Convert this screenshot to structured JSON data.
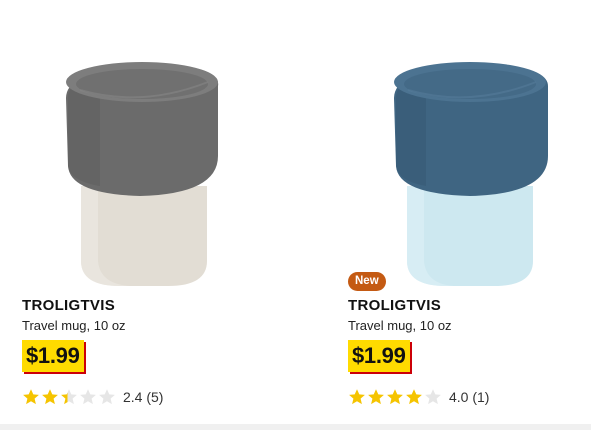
{
  "products": [
    {
      "badge": "",
      "name": "TROLIGTVIS",
      "description": "Travel mug, 10 oz",
      "price": "$1.99",
      "rating_value": 2.4,
      "rating_text": "2.4 (5)",
      "colors": {
        "lid": "#6b6b6b",
        "body": "#e2ddd4"
      }
    },
    {
      "badge": "New",
      "name": "TROLIGTVIS",
      "description": "Travel mug, 10 oz",
      "price": "$1.99",
      "rating_value": 4.0,
      "rating_text": "4.0 (1)",
      "colors": {
        "lid": "#3f6582",
        "body": "#cde8f0"
      }
    }
  ],
  "colors": {
    "price_bg": "#ffdb00",
    "price_shadow": "#cc0008",
    "star_filled": "#f5c400",
    "star_empty": "#e6e6e6",
    "badge_bg": "#c45a13"
  }
}
